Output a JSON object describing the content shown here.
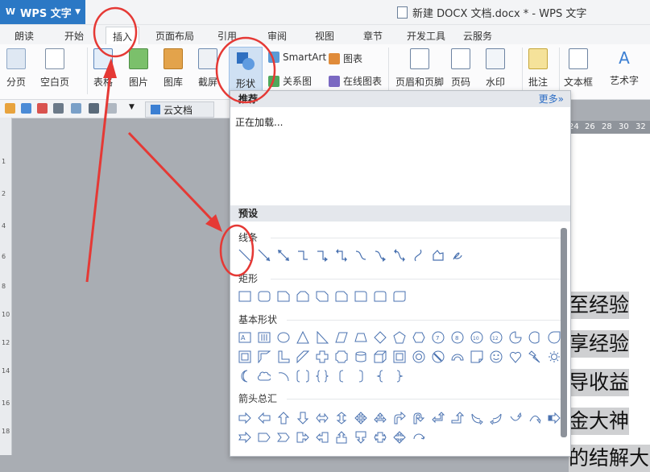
{
  "app": {
    "name": "WPS 文字",
    "doc_title": "新建 DOCX 文档.docx * - WPS 文字"
  },
  "tabs": [
    "朗读",
    "开始",
    "插入",
    "页面布局",
    "引用",
    "审阅",
    "视图",
    "章节",
    "开发工具",
    "云服务"
  ],
  "ribbon": {
    "page_break": "分页",
    "blank_page": "空白页",
    "table": "表格",
    "picture": "图片",
    "gallery": "图库",
    "screenshot": "截屏",
    "shape": "形状",
    "smartart": "SmartArt",
    "chart": "图表",
    "relation": "关系图",
    "online_chart": "在线图表",
    "header_footer": "页眉和页脚",
    "page_number": "页码",
    "watermark": "水印",
    "comment": "批注",
    "textbox": "文本框",
    "wordart": "艺术字"
  },
  "quickbar": {
    "cloud_doc": "云文档"
  },
  "ruler": {
    "top_numbers": [
      "24",
      "26",
      "28",
      "30",
      "32"
    ],
    "left_numbers": [
      "1",
      "2",
      "4",
      "6",
      "8",
      "10",
      "12",
      "14",
      "16",
      "18"
    ]
  },
  "panel": {
    "recommended": "推荐",
    "more": "更多»",
    "loading": "正在加载...",
    "presets": "预设",
    "categories": [
      "线条",
      "矩形",
      "基本形状",
      "箭头总汇"
    ]
  },
  "document_lines": [
    "至经验",
    "享经验",
    "导收益",
    "金大神",
    "的结解大下"
  ],
  "colors": {
    "accent": "#2b78c5",
    "annotation": "#e53935"
  }
}
